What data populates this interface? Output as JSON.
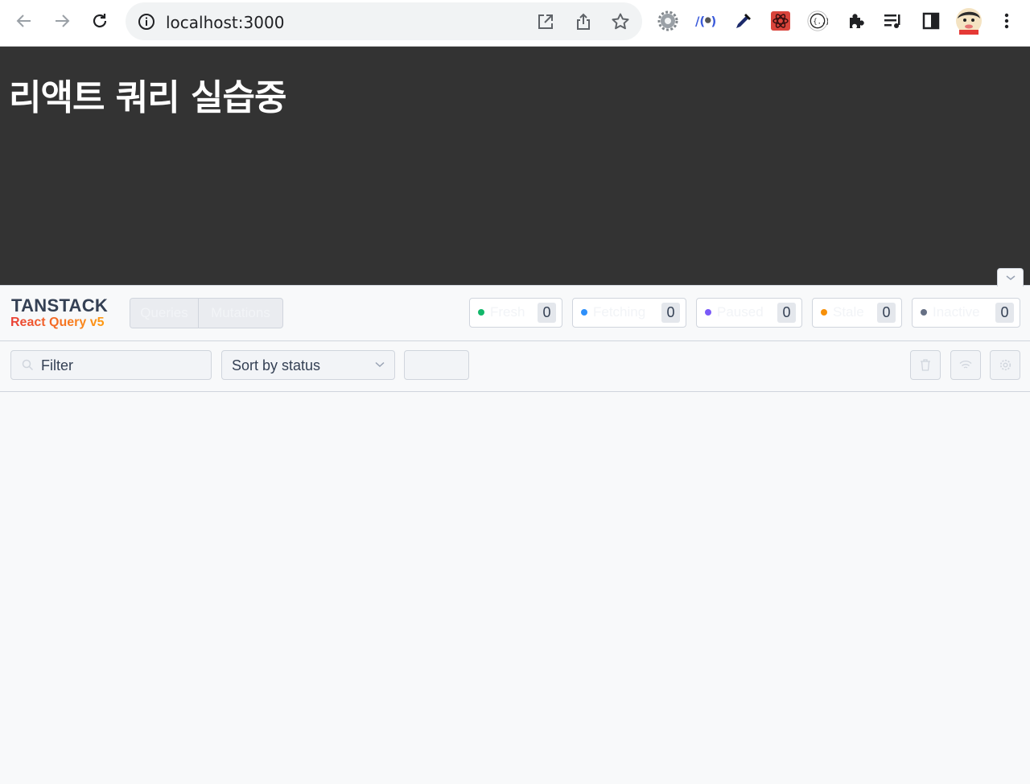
{
  "browser": {
    "url": "localhost:3000",
    "icons": [
      "back-icon",
      "forward-icon",
      "reload-icon",
      "site-info-icon",
      "open-in-app-icon",
      "share-icon",
      "bookmark-star-icon",
      "extension-gear-icon",
      "extension-w-icon",
      "eyedropper-icon",
      "extension-react-devtools-icon",
      "extension-json-icon",
      "extensions-puzzle-icon",
      "reading-list-icon",
      "side-panel-icon",
      "profile-avatar",
      "menu-kebab-icon"
    ]
  },
  "page": {
    "heading": "리액트 쿼리 실습중"
  },
  "devtools": {
    "brand_top": "TANSTACK",
    "brand_bottom": "React Query v5",
    "tabs": [
      "Queries",
      "Mutations"
    ],
    "status_badges": [
      {
        "label": "Fresh",
        "count": "0",
        "color": "#12b76a"
      },
      {
        "label": "Fetching",
        "count": "0",
        "color": "#2e90fa"
      },
      {
        "label": "Paused",
        "count": "0",
        "color": "#7a5af8"
      },
      {
        "label": "Stale",
        "count": "0",
        "color": "#f79009"
      },
      {
        "label": "Inactive",
        "count": "0",
        "color": "#667085"
      }
    ],
    "filter_placeholder": "Filter",
    "sort_value": "Sort by status",
    "order_label": "Asc",
    "order_arrow": "↑",
    "tool_buttons": [
      "clear-cache-trash-icon",
      "offline-wifi-icon",
      "settings-gear-icon"
    ]
  }
}
